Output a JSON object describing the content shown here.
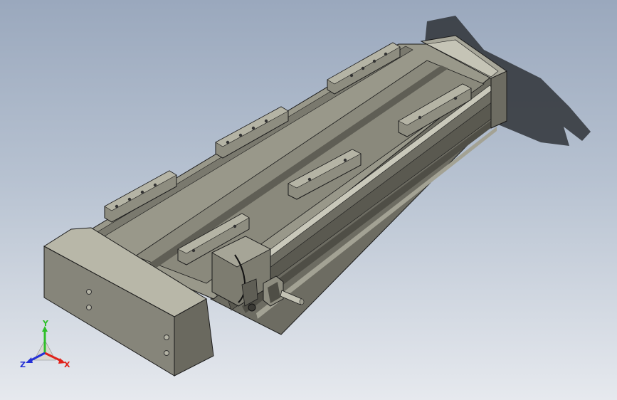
{
  "viewport": {
    "background_top": "#9aa8bd",
    "background_bottom": "#e6e9ee"
  },
  "model": {
    "body_color": "#8e8d80",
    "body_light": "#b5b4a5",
    "body_dark": "#5f5e55",
    "edge_color": "#1b1b1b",
    "shadow_color": "#2f3337"
  },
  "triad": {
    "icon": "axis-triad-icon",
    "x_label": "X",
    "y_label": "Y",
    "z_label": "Z",
    "x_color": "#e0221b",
    "y_color": "#2fbf2a",
    "z_color": "#2430d6"
  }
}
